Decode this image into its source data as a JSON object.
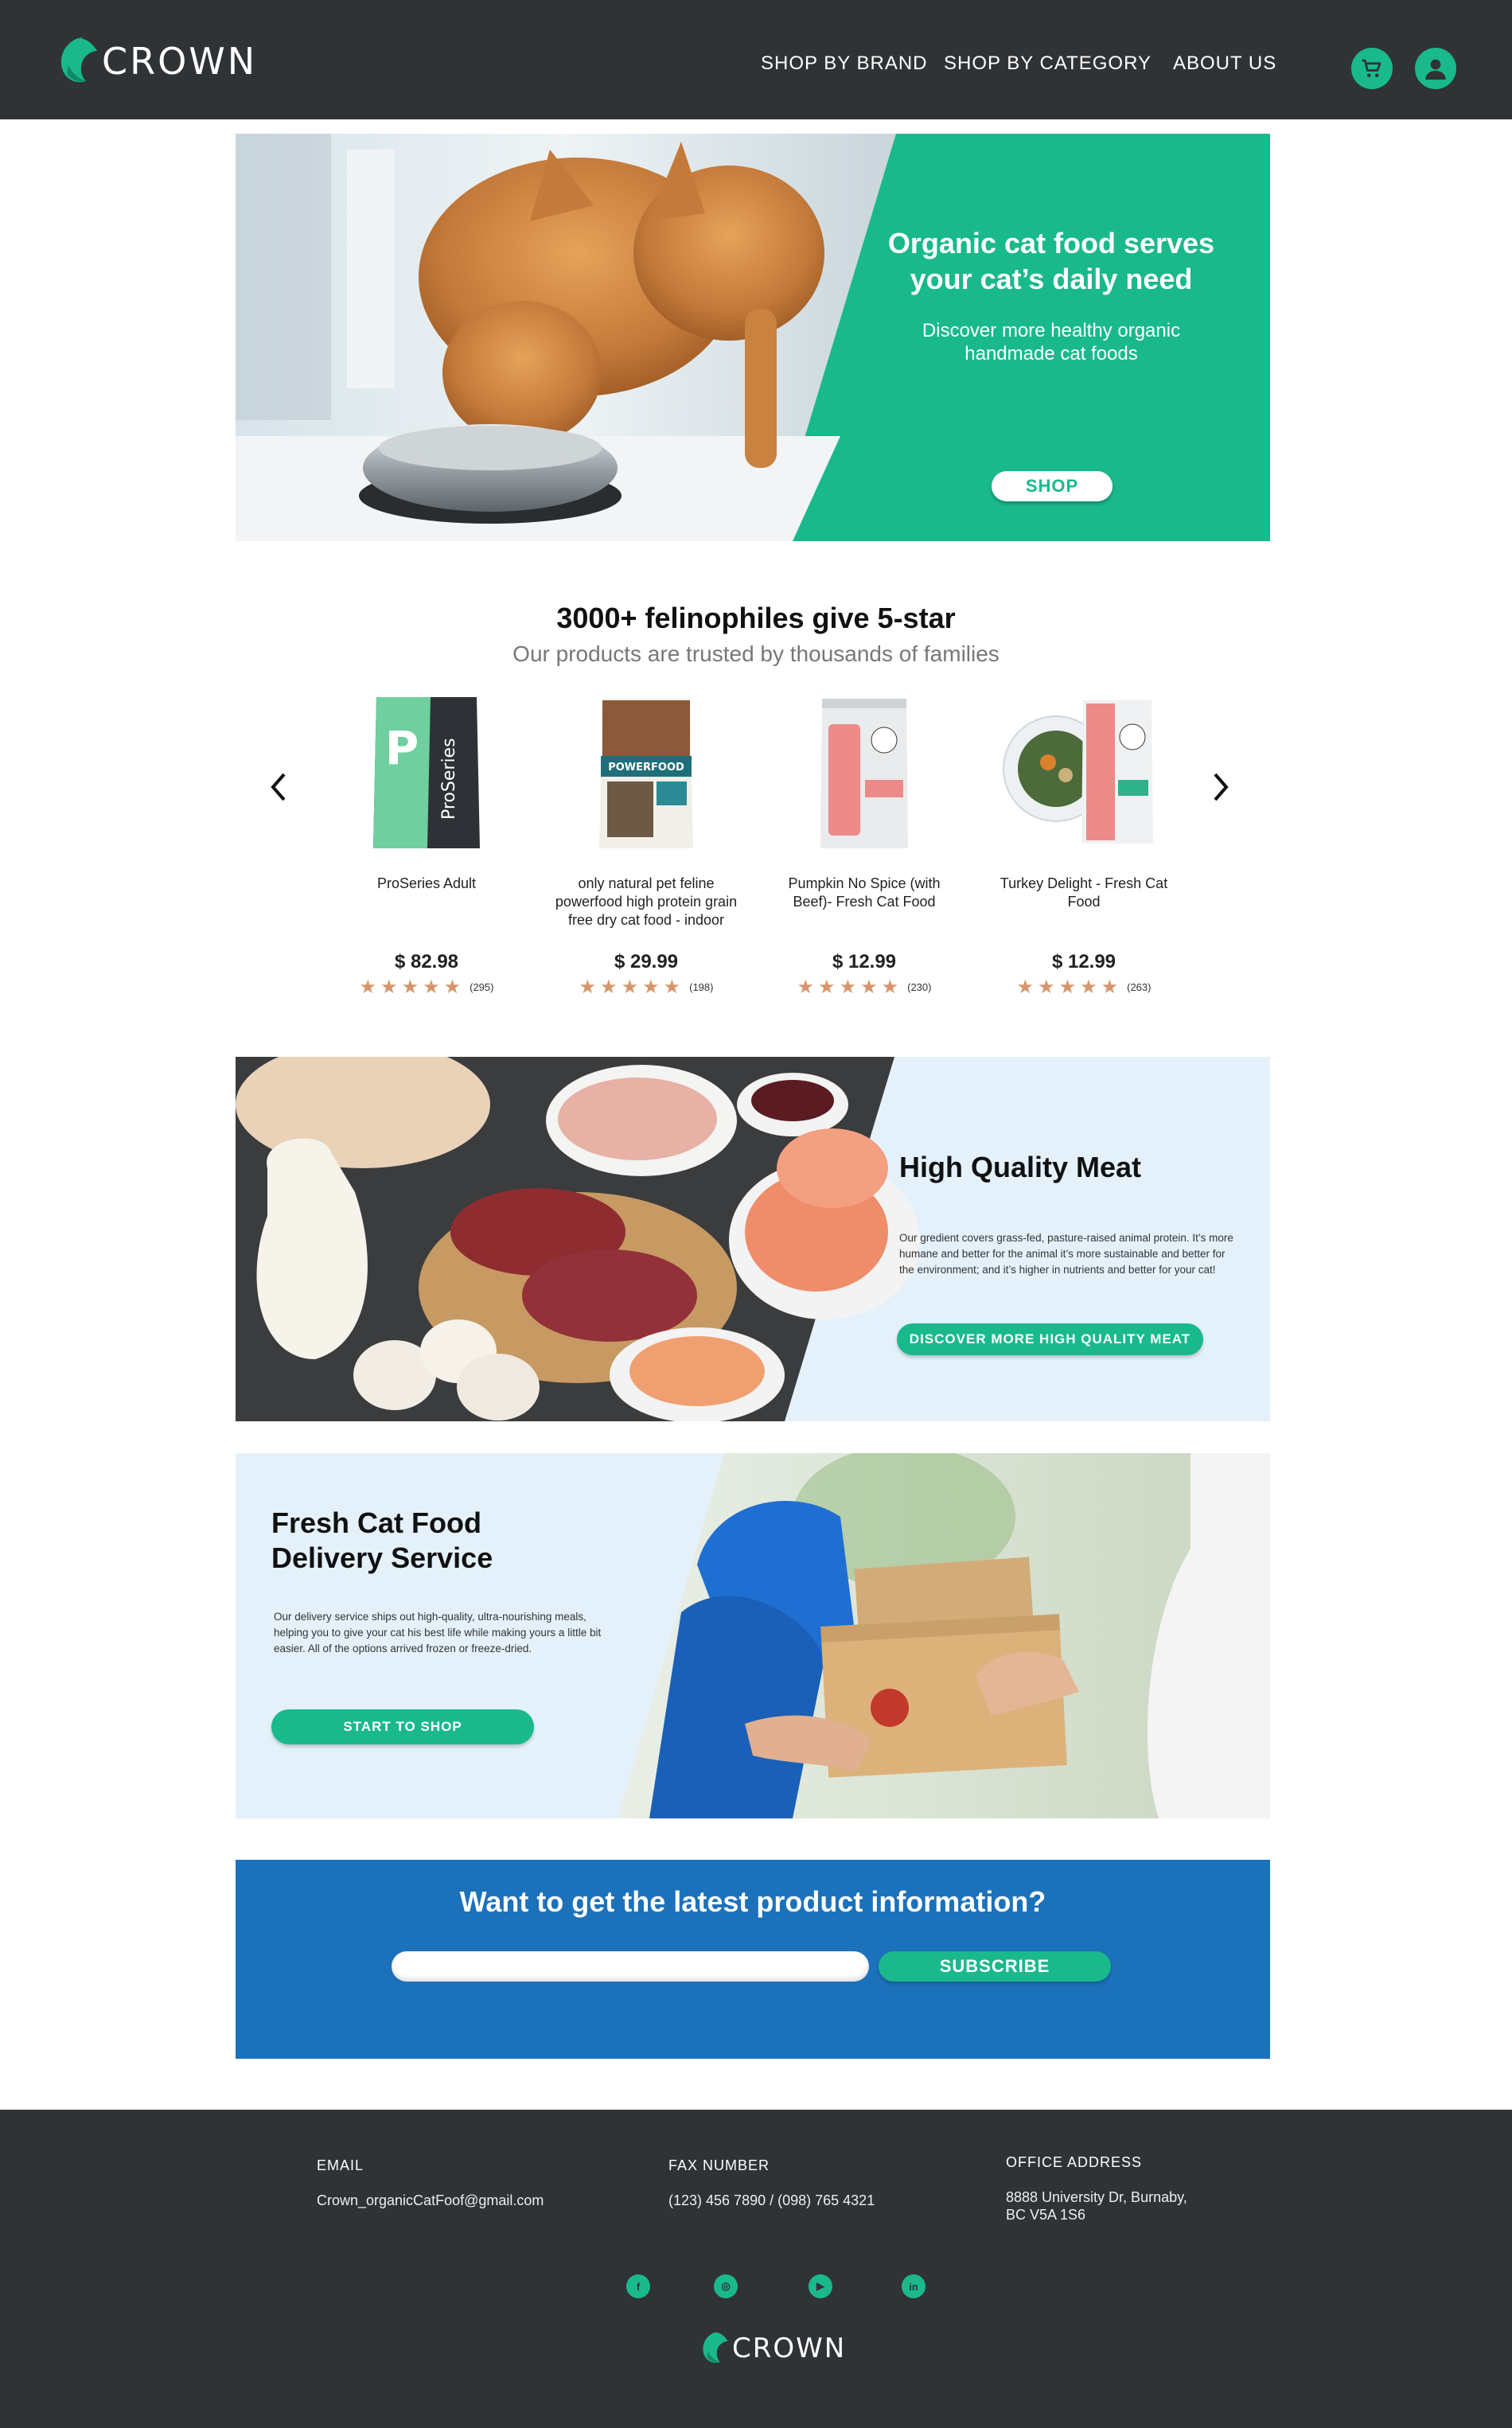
{
  "header": {
    "logo_text": "CROWN",
    "nav": [
      "SHOP BY BRAND",
      "SHOP BY CATEGORY",
      "ABOUT US"
    ],
    "icons": [
      "cart-icon",
      "user-icon"
    ]
  },
  "hero": {
    "title": "Organic cat food serves your cat’s daily need",
    "subtitle": "Discover more healthy organic handmade cat foods",
    "button": "SHOP"
  },
  "products": {
    "title": "3000+ felinophiles give 5-star",
    "subtitle": "Our products are trusted by thousands of families",
    "items": [
      {
        "name": "ProSeries Adult",
        "price": "$ 82.98",
        "stars": "★★★★★",
        "reviews": "(295)"
      },
      {
        "name": "only natural pet feline powerfood high protein grain free dry cat food - indoor",
        "price": "$ 29.99",
        "stars": "★★★★★",
        "reviews": "(198)"
      },
      {
        "name": "Pumpkin No Spice (with Beef)- Fresh Cat Food",
        "price": "$ 12.99",
        "stars": "★★★★★",
        "reviews": "(230)"
      },
      {
        "name": "Turkey Delight - Fresh Cat Food",
        "price": "$ 12.99",
        "stars": "★★★★★",
        "reviews": "(263)"
      }
    ]
  },
  "meat": {
    "title": "High Quality  Meat",
    "description": "Our gredient covers grass-fed, pasture-raised animal protein. It’s more humane and better for the animal it’s more sustainable and better for the environment; and it’s higher in nutrients and better for your cat!",
    "button": "DISCOVER MORE HIGH QUALITY MEAT"
  },
  "delivery": {
    "title_line1": "Fresh Cat Food",
    "title_line2": "Delivery Service",
    "description": "Our delivery service ships out high-quality, ultra-nourishing meals, helping you to give your cat his best life while making yours a little bit easier. All of the options arrived frozen or freeze-dried.",
    "button": "START TO SHOP"
  },
  "newsletter": {
    "title": "Want to get the latest product information?",
    "input_placeholder": "",
    "button": "SUBSCRIBE"
  },
  "footer": {
    "email_label": "EMAIL",
    "email": "Crown_organicCatFoof@gmail.com",
    "fax_label": "FAX NUMBER",
    "fax": "(123) 456 7890 / (098) 765 4321",
    "address_label": "OFFICE ADDRESS",
    "address_line1": "8888 University Dr, Burnaby,",
    "address_line2": "BC V5A 1S6",
    "social": [
      "facebook-icon",
      "instagram-icon",
      "youtube-icon",
      "linkedin-icon"
    ],
    "social_glyphs": [
      "f",
      "◎",
      "▶",
      "in"
    ],
    "logo_text": "CROWN"
  },
  "colors": {
    "accent": "#19b98c",
    "dark": "#303336",
    "blue": "#1c71bb",
    "light_blue": "#e4f1fb",
    "star": "#d7956a"
  }
}
